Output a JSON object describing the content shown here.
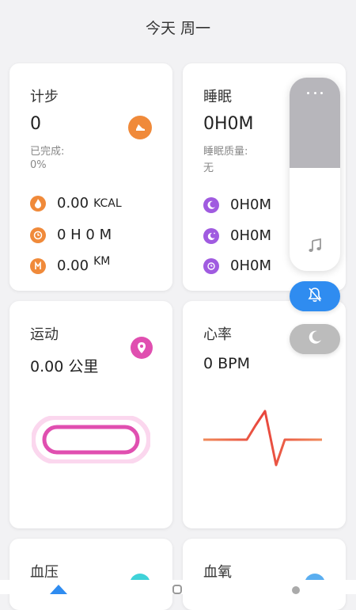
{
  "header": {
    "title": "今天 周一"
  },
  "steps": {
    "title": "计步",
    "value": "0",
    "completed_label": "已完成:",
    "completed_value": "0%",
    "metrics": [
      {
        "icon": "flame-icon",
        "value": "0.00",
        "unit": "KCAL",
        "color": "#f08a3a"
      },
      {
        "icon": "clock-icon",
        "value": "0 H 0 M",
        "unit": "",
        "color": "#f08a3a"
      },
      {
        "icon": "distance-icon",
        "value": "0.00",
        "unit": "KM",
        "color": "#f08a3a"
      }
    ]
  },
  "sleep": {
    "title": "睡眠",
    "value": "0H0M",
    "quality_label": "睡眠质量:",
    "quality_value": "无",
    "metrics": [
      {
        "icon": "moon-icon",
        "value": "0H0M",
        "color": "#a05be0"
      },
      {
        "icon": "moon-stars-icon",
        "value": "0H0M",
        "color": "#a05be0"
      },
      {
        "icon": "moon-clock-icon",
        "value": "0H0M",
        "color": "#a05be0"
      }
    ]
  },
  "exercise": {
    "title": "运动",
    "value": "0.00 公里"
  },
  "heart": {
    "title": "心率",
    "value": "0 BPM"
  },
  "blood_pressure": {
    "title": "血压"
  },
  "blood_oxygen": {
    "title": "血氧"
  },
  "colors": {
    "accent_orange": "#f08a3a",
    "accent_purple": "#a05be0",
    "accent_pink": "#e04fb0",
    "accent_blue": "#2f8cf0",
    "heart_red": "#e8453c"
  }
}
